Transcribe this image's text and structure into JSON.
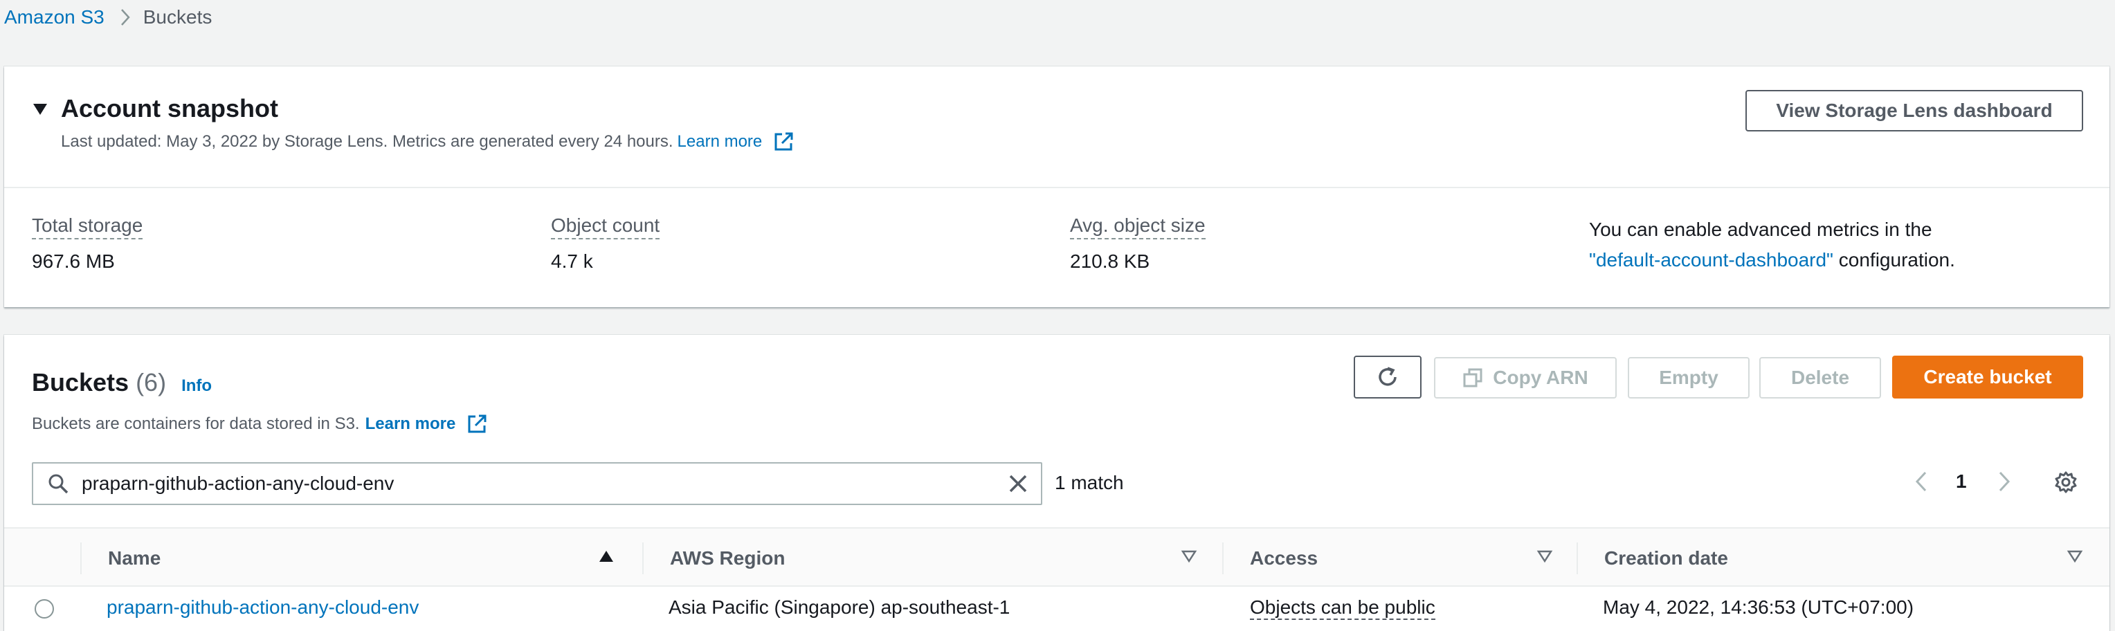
{
  "breadcrumb": {
    "root": "Amazon S3",
    "current": "Buckets"
  },
  "snapshot": {
    "title": "Account snapshot",
    "subtitle": "Last updated: May 3, 2022 by Storage Lens. Metrics are generated every 24 hours.",
    "learn_more": "Learn more",
    "view_button": "View Storage Lens dashboard",
    "metrics": [
      {
        "label": "Total storage",
        "value": "967.6 MB"
      },
      {
        "label": "Object count",
        "value": "4.7 k"
      },
      {
        "label": "Avg. object size",
        "value": "210.8 KB"
      }
    ],
    "advanced": {
      "prefix": "You can enable advanced metrics in the",
      "link": "\"default-account-dashboard\"",
      "suffix": " configuration."
    }
  },
  "buckets": {
    "title": "Buckets",
    "count": "(6)",
    "info": "Info",
    "description": "Buckets are containers for data stored in S3.",
    "learn_more": "Learn more",
    "buttons": {
      "copy_arn": "Copy ARN",
      "empty": "Empty",
      "delete": "Delete",
      "create": "Create bucket"
    },
    "search_value": "praparn-github-action-any-cloud-env",
    "match_text": "1 match",
    "page": "1",
    "columns": [
      "Name",
      "AWS Region",
      "Access",
      "Creation date"
    ],
    "rows": [
      {
        "name": "praparn-github-action-any-cloud-env",
        "region": "Asia Pacific (Singapore) ap-southeast-1",
        "access": "Objects can be public",
        "created": "May 4, 2022, 14:36:53 (UTC+07:00)"
      }
    ]
  },
  "colors": {
    "link": "#0073bb",
    "primary_button": "#ec7211",
    "text": "#16191f",
    "secondary_text": "#545b64"
  }
}
